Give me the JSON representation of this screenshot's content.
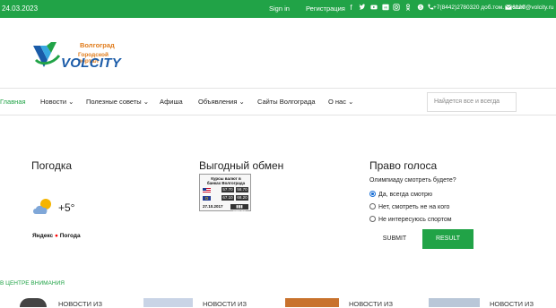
{
  "topbar": {
    "date": "24.03.2023",
    "signin": "Sign in",
    "register": "Регистрация",
    "phone": "+7(8442)2780320 доб.том. 276120",
    "email": "shelf@volcity.ru"
  },
  "logo": {
    "city": "Волгоград",
    "portal": "Городской портал",
    "brand": "VOLCITY"
  },
  "nav": {
    "items": [
      "Главная",
      "Новости",
      "Полезные советы",
      "Афиша",
      "Объявления",
      "Сайты Волгограда",
      "О нас"
    ],
    "search_placeholder": "Найдется все и всегда"
  },
  "weather": {
    "title": "Погодка",
    "temp": "+5°",
    "source_ya": "Яндекс",
    "source": "Погода"
  },
  "exchange": {
    "title": "Выгодный обмен",
    "header": "Курсы валют в банках Волгограда",
    "rows": [
      {
        "buy": "57.70",
        "sell": "58.70"
      },
      {
        "buy": "67.10",
        "sell": "68.20"
      }
    ],
    "date": "27.10.2017",
    "extra": "▮▮▮ 830.02"
  },
  "poll": {
    "title": "Право голоса",
    "question": "Олимпиаду смотреть будете?",
    "options": [
      "Да, всегда смотрю",
      "Нет, смотреть не на кого",
      "Не интересуюсь спортом"
    ],
    "submit": "SUBMIT",
    "result": "RESULT"
  },
  "focus": {
    "label": "В ЦЕНТРЕ ВНИМАНИЯ",
    "news": [
      "НОВОСТИ ИЗ",
      "НОВОСТИ ИЗ",
      "НОВОСТИ ИЗ",
      "НОВОСТИ ИЗ"
    ]
  },
  "colors": {
    "accent": "#21a347",
    "brand": "#1a5ba8",
    "brand_orange": "#e07b1a"
  }
}
